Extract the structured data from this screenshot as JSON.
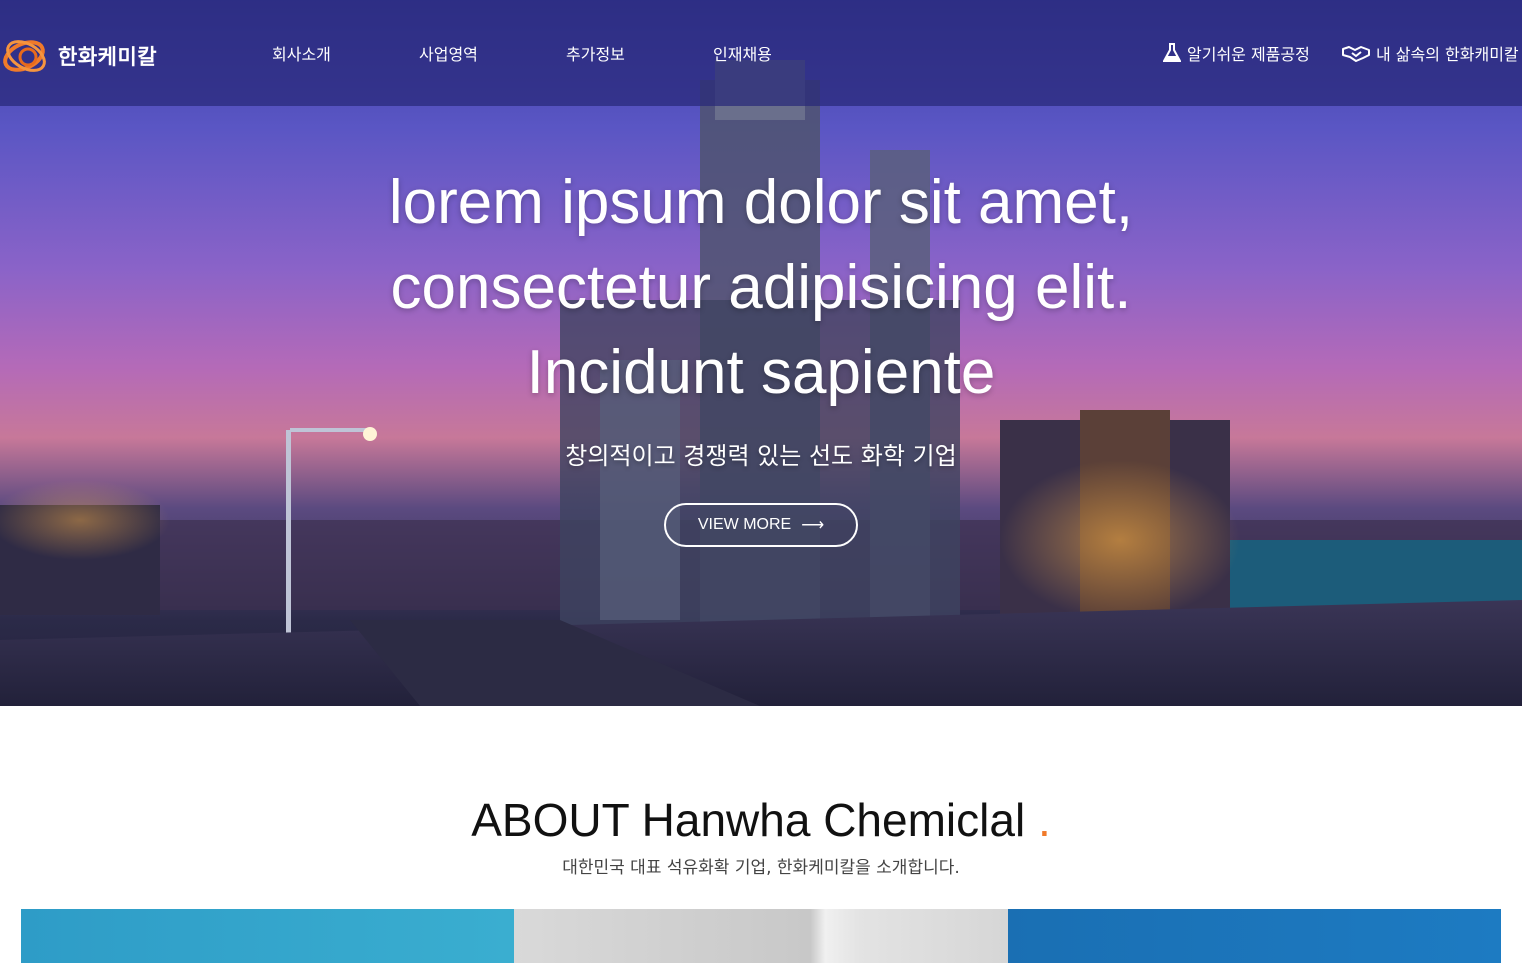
{
  "brand": {
    "name": "한화케미칼",
    "logo_icon": "hanwha-orbit-logo"
  },
  "nav": {
    "items": [
      {
        "label": "회사소개"
      },
      {
        "label": "사업영역"
      },
      {
        "label": "추가정보"
      },
      {
        "label": "인재채용"
      }
    ],
    "utility": [
      {
        "label": "알기쉬운 제품공정",
        "icon": "flask-icon"
      },
      {
        "label": "내 삶속의 한화캐미칼",
        "icon": "handshake-icon"
      }
    ]
  },
  "hero": {
    "title_lines": [
      "lorem ipsum dolor sit amet,",
      "consectetur adipisicing elit.",
      "Incidunt sapiente"
    ],
    "subtitle": "창의적이고 경쟁력 있는 선도 화학 기업",
    "cta_label": "VIEW MORE",
    "cta_arrow": "⟶"
  },
  "about": {
    "title": "ABOUT Hanwha Chemiclal",
    "title_dot": ".",
    "subtitle": "대한민국 대표 석유화확 기업, 한화케미칼을 소개합니다."
  },
  "colors": {
    "nav_bg": "#28287a",
    "accent_orange": "#f07a2a",
    "card_blue_light": "#2e9cc7",
    "card_blue_dark": "#1a6fb3"
  }
}
